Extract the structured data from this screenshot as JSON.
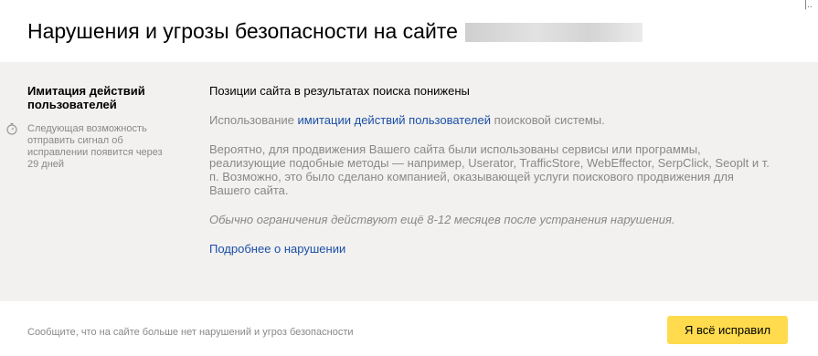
{
  "header": {
    "title": "Нарушения и угрозы безопасности на сайте",
    "corner_mark": "|.."
  },
  "violation": {
    "name": "Имитация действий пользователей",
    "deadline": "Следующая возможность отправить сигнал об исправлении появится через 29 дней",
    "consequence": "Позиции сайта в результатах поиска понижены",
    "usage_prefix": "Использование",
    "usage_link": "имитации действий пользователей",
    "usage_suffix": "поисковой системы.",
    "explanation": "Вероятно, для продвижения Вашего сайта были использованы сервисы или программы, реализующие подобные методы — например, Userator, TrafficStore, WebEffector, SerpClick, Seoplt и т. п. Возможно, это было сделано компанией, оказывающей услуги поискового продвижения для Вашего сайта.",
    "duration_note": "Обычно ограничения действуют ещё 8-12 месяцев после устранения нарушения.",
    "more_link": "Подробнее о нарушении"
  },
  "footer": {
    "text": "Сообщите, что на сайте больше нет нарушений и угроз безопасности",
    "button_label": "Я всё исправил"
  },
  "colors": {
    "panel_background": "#f2f1ef",
    "link": "#1a4fa8",
    "muted_text": "#888888",
    "button_background": "#ffdb4d"
  },
  "icons": {
    "deadline": "timer-icon"
  }
}
